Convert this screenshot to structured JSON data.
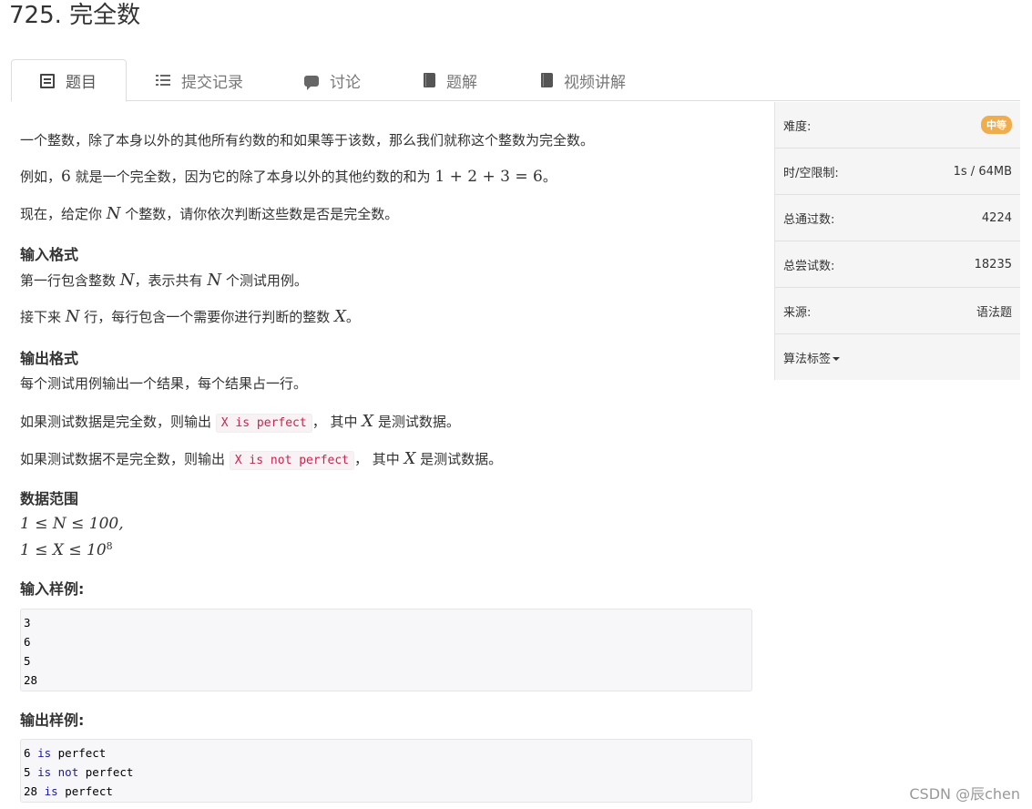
{
  "title": "725. 完全数",
  "tabs": [
    {
      "label": "题目",
      "icon": "document-icon"
    },
    {
      "label": "提交记录",
      "icon": "list-icon"
    },
    {
      "label": "讨论",
      "icon": "chat-icon"
    },
    {
      "label": "题解",
      "icon": "book-icon"
    },
    {
      "label": "视频讲解",
      "icon": "book-icon"
    }
  ],
  "desc": {
    "p1": "一个整数，除了本身以外的其他所有约数的和如果等于该数，那么我们就称这个整数为完全数。",
    "p2a": "例如，",
    "p2n": "6",
    "p2b": " 就是一个完全数，因为它的除了本身以外的其他约数的和为 ",
    "p2eq": "1 + 2 + 3 = 6",
    "p2c": "。",
    "p3a": "现在，给定你 ",
    "p3n": "N",
    "p3b": " 个整数，请你依次判断这些数是否是完全数。"
  },
  "input_format": {
    "heading": "输入格式",
    "l1a": "第一行包含整数 ",
    "l1n": "N",
    "l1b": "，表示共有 ",
    "l1n2": "N",
    "l1c": " 个测试用例。",
    "l2a": "接下来 ",
    "l2n": "N",
    "l2b": " 行，每行包含一个需要你进行判断的整数 ",
    "l2x": "X",
    "l2c": "。"
  },
  "output_format": {
    "heading": "输出格式",
    "l1": "每个测试用例输出一个结果，每个结果占一行。",
    "l2a": "如果测试数据是完全数，则输出 ",
    "l2code": "X is perfect",
    "l2b": "， 其中 ",
    "l2x": "X",
    "l2c": " 是测试数据。",
    "l3a": "如果测试数据不是完全数，则输出 ",
    "l3code": "X is not perfect",
    "l3b": "， 其中 ",
    "l3x": "X",
    "l3c": " 是测试数据。"
  },
  "range": {
    "heading": "数据范围",
    "r1": "1 ≤ N ≤ 100,",
    "r2a": "1 ≤ X ≤ 10",
    "r2exp": "8"
  },
  "sample_input": {
    "heading": "输入样例:",
    "lines": [
      "3",
      "6",
      "5",
      "28"
    ]
  },
  "sample_output": {
    "heading": "输出样例:",
    "lines": [
      {
        "num": "6",
        "kw": "is",
        "kw2": "",
        "rest": "perfect"
      },
      {
        "num": "5",
        "kw": "is",
        "kw2": "not",
        "rest": "perfect"
      },
      {
        "num": "28",
        "kw": "is",
        "kw2": "",
        "rest": "perfect"
      }
    ]
  },
  "sidebar": {
    "difficulty_label": "难度:",
    "difficulty_value": "中等",
    "limit_label": "时/空限制:",
    "limit_value": "1s / 64MB",
    "passed_label": "总通过数:",
    "passed_value": "4224",
    "tried_label": "总尝试数:",
    "tried_value": "18235",
    "source_label": "来源:",
    "source_value": "语法题",
    "tags_label": "算法标签"
  },
  "watermark": "CSDN @辰chen",
  "colors": {
    "badge": "#f0ad4e",
    "keyword": "#1a1aa6",
    "inline_code": "#c7254e"
  }
}
